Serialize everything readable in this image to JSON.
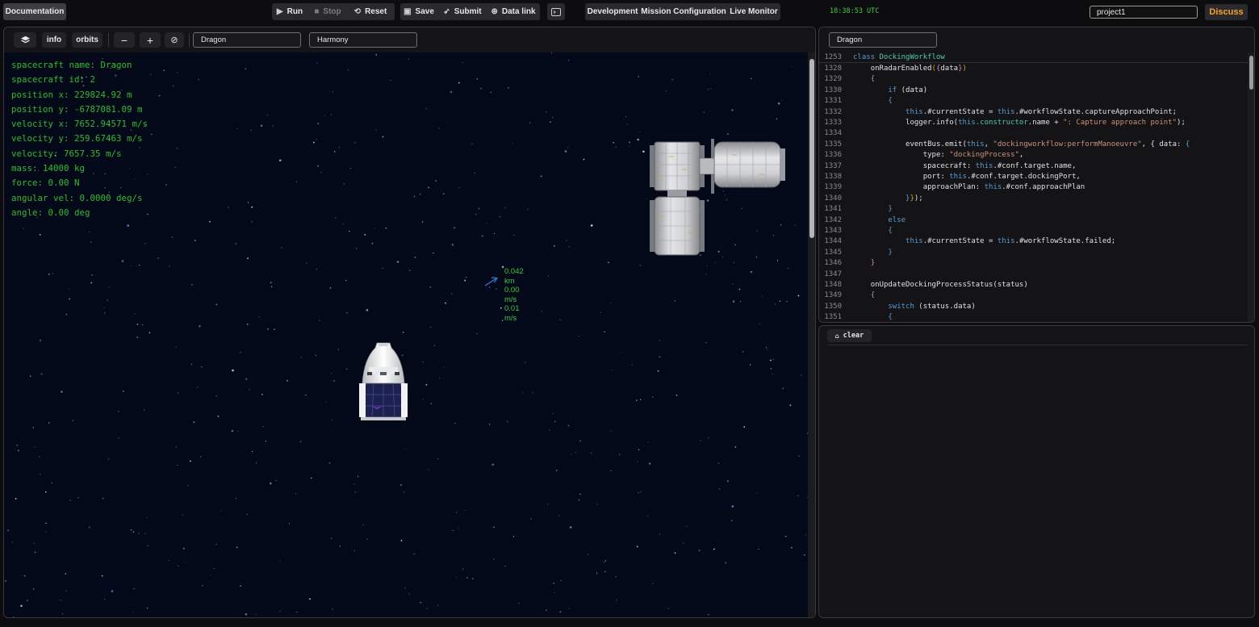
{
  "topbar": {
    "documentation": "Documentation",
    "run": "Run",
    "stop": "Stop",
    "reset": "Reset",
    "save": "Save",
    "submit": "Submit",
    "data_link": "Data link",
    "tabs": [
      "Development",
      "Mission Configuration",
      "Live Monitor"
    ],
    "clock": "18:38:53 UTC",
    "project": "project1",
    "discuss": "Discuss",
    "accent_color": "#f5a623"
  },
  "sim": {
    "toolbar": {
      "layers_icon": "layers-icon",
      "info": "info",
      "orbits": "orbits",
      "zoom_out": "−",
      "zoom_in": "+",
      "reset_view": "⊘",
      "spacecraft": "Dragon",
      "target": "Harmony"
    },
    "telemetry": [
      "spacecraft name: Dragon",
      "spacecraft id: 2",
      "position x: 229824.92 m",
      "position y: -6787081.09 m",
      "velocity x: 7652.94571 m/s",
      "velocity y: 259.67463 m/s",
      "velocity: 7657.35 m/s",
      "mass: 14000 kg",
      "force: 0.00 N",
      "angular vel: 0.0000 deg/s",
      "angle: 0.00 deg"
    ],
    "radar": {
      "distance": "0.042 km",
      "velocity_1": "0.00 m/s",
      "velocity_2": "0.01 m/s"
    }
  },
  "code": {
    "target": "Dragon",
    "sticky": {
      "line": "1253",
      "text": "class DockingWorkflow"
    },
    "lines": [
      {
        "n": "1328"
      },
      {
        "n": "1329"
      },
      {
        "n": "1330"
      },
      {
        "n": "1331"
      },
      {
        "n": "1332"
      },
      {
        "n": "1333"
      },
      {
        "n": "1334"
      },
      {
        "n": "1335"
      },
      {
        "n": "1336"
      },
      {
        "n": "1337"
      },
      {
        "n": "1338"
      },
      {
        "n": "1339"
      },
      {
        "n": "1340"
      },
      {
        "n": "1341"
      },
      {
        "n": "1342"
      },
      {
        "n": "1343"
      },
      {
        "n": "1344"
      },
      {
        "n": "1345"
      },
      {
        "n": "1346"
      },
      {
        "n": "1347"
      },
      {
        "n": "1348"
      },
      {
        "n": "1349"
      },
      {
        "n": "1350"
      },
      {
        "n": "1351"
      }
    ],
    "t": {
      "onRadarEnabled": "onRadarEnabled",
      "data": "data",
      "if": "if",
      "this": "this",
      "currentState": ".#currentState = ",
      "capture": ".#workflowState.captureApproachPoint;",
      "logger": "logger.info(",
      "ctor": ".constructor",
      "name_plus": ".name + ",
      "capture_str": "\": Capture approach point\"",
      "eventBus": "eventBus.emit(",
      "comma": ", ",
      "dw_str": "\"dockingworkflow:performManoeuvre\"",
      "data_obj": ", { data: ",
      "type_key": "type: ",
      "type_str": "\"dockingProcess\"",
      "spacecraft_key": "spacecraft: ",
      "target_name": ".#conf.target.name,",
      "port_key": "port: ",
      "docking_port": ".#conf.target.dockingPort,",
      "approach_key": "approachPlan: ",
      "approach_plan": ".#conf.approachPlan",
      "else": "else",
      "failed": ".#workflowState.failed;",
      "onUpdate": "onUpdateDockingProcessStatus",
      "status": "status",
      "switch": "switch",
      "status_data": "status.data"
    }
  },
  "console": {
    "clear": "clear"
  }
}
